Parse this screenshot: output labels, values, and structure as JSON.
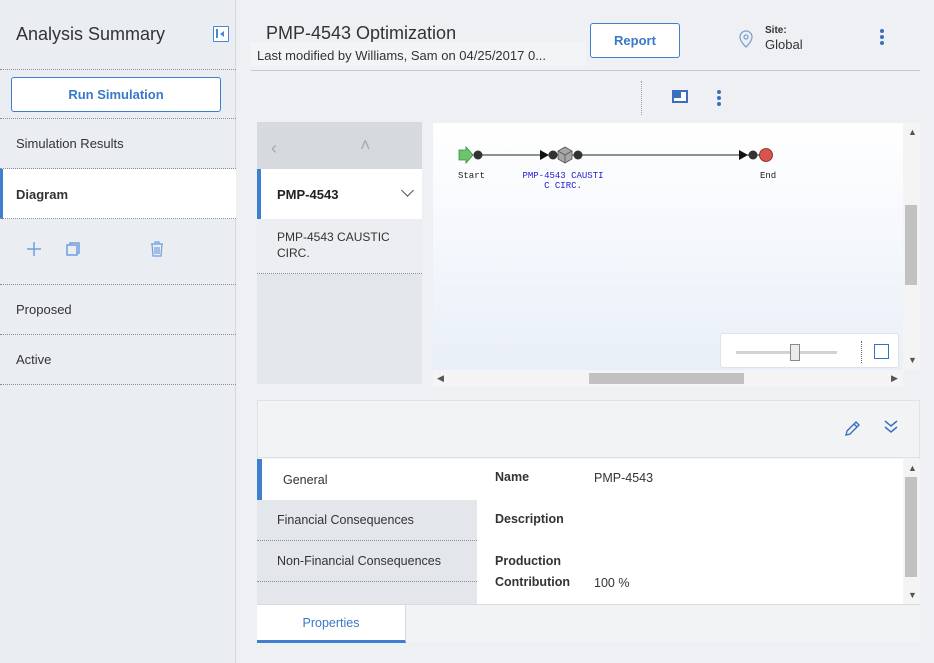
{
  "sidebar": {
    "title": "Analysis Summary",
    "run_button": "Run Simulation",
    "items": [
      {
        "label": "Simulation Results"
      },
      {
        "label": "Diagram"
      },
      {
        "label": "Proposed"
      },
      {
        "label": "Active"
      }
    ],
    "action_icons": [
      "add-icon",
      "copy-icon",
      "trash-icon"
    ]
  },
  "header": {
    "title": "PMP-4543 Optimization",
    "subtitle": "Last modified by Williams, Sam on 04/25/2017 0...",
    "report_button": "Report",
    "site_label": "Site:",
    "site_value": "Global"
  },
  "tree": {
    "selected": "PMP-4543",
    "child": "PMP-4543 CAUSTIC CIRC."
  },
  "diagram": {
    "start_label": "Start",
    "node_label_line1": "PMP-4543 CAUSTI",
    "node_label_line2": "C CIRC.",
    "end_label": "End",
    "colors": {
      "start": "#5cb85c",
      "end": "#d9534f",
      "node_text": "#1f1fd0"
    },
    "zoom_level": 0.6
  },
  "properties": {
    "tabs": [
      "General",
      "Financial Consequences",
      "Non-Financial Consequences"
    ],
    "fields": {
      "name_label": "Name",
      "name_value": "PMP-4543",
      "description_label": "Description",
      "production_label_1": "Production",
      "production_label_2": "Contribution",
      "production_value": "100 %"
    },
    "bottom_tab": "Properties"
  }
}
